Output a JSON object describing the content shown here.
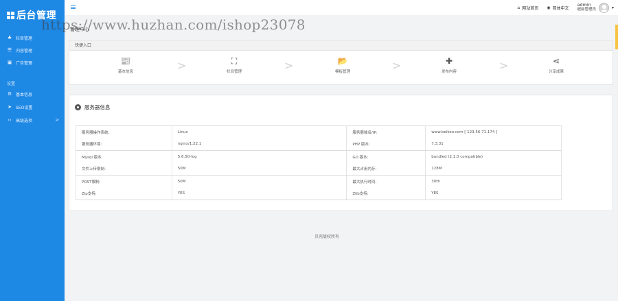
{
  "sidebar": {
    "logo": "后台管理",
    "items": [
      {
        "label": "栏目管理",
        "icon": "sitemap-icon"
      },
      {
        "label": "内容管理",
        "icon": "list-icon"
      },
      {
        "label": "广告管理",
        "icon": "image-icon"
      }
    ],
    "section_label": "设置",
    "settings_items": [
      {
        "label": "基本信息",
        "icon": "gear-icon"
      },
      {
        "label": "SEO设置",
        "icon": "send-icon"
      },
      {
        "label": "高级选项",
        "icon": "code-icon",
        "arrow": ">"
      }
    ]
  },
  "topbar": {
    "menu_icon": "≡",
    "site_home": "网站首页",
    "language": "简体中文",
    "admin_name": "admin",
    "admin_role": "超级管理员",
    "dropdown": "▾"
  },
  "watermark": "https://www.huzhan.com/ishop23078",
  "breadcrumb": "管理中心",
  "quick": {
    "title": "快捷入口",
    "items": [
      {
        "label": "基本信息",
        "icon": "newspaper-icon",
        "glyph": "📰"
      },
      {
        "label": "栏目管理",
        "icon": "sitemap-icon",
        "glyph": "⛶"
      },
      {
        "label": "模板管理",
        "icon": "folder-open-icon",
        "glyph": "📂"
      },
      {
        "label": "发布内容",
        "icon": "plus-icon",
        "glyph": "✚"
      },
      {
        "label": "分享成果",
        "icon": "share-icon",
        "glyph": "⋖"
      }
    ],
    "separator": ">"
  },
  "server": {
    "title": "服务器信息",
    "rows": [
      [
        "服务器操作系统:",
        "Linux",
        "服务器域名/IP:",
        "www.beikeo.com [ 123.56.71.174 ]"
      ],
      [
        "服务器环境:",
        "nginx/1.22.1",
        "PHP 版本:",
        "7.3.31"
      ],
      [
        "Mysql 版本:",
        "5.6.50-log",
        "GD 版本:",
        "bundled (2.1.0 compatible)"
      ],
      [
        "文件上传限制:",
        "50M",
        "最大占用内存:",
        "128M"
      ],
      [
        "POST限制:",
        "50M",
        "最大执行时间:",
        "30th"
      ],
      [
        "Zip支持:",
        "YES",
        "Zlib支持:",
        "YES"
      ]
    ]
  },
  "footer": "贝壳版权所有"
}
